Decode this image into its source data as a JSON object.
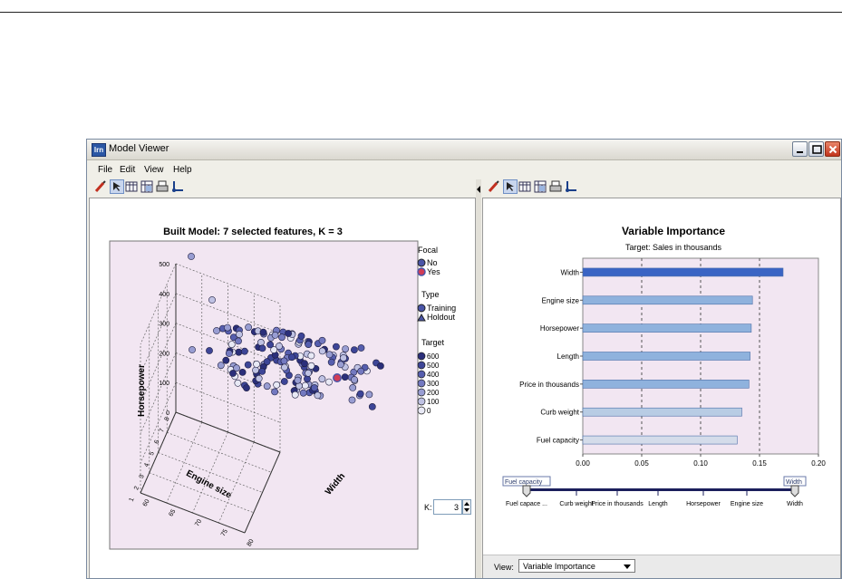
{
  "window": {
    "title": "Model Viewer",
    "app_icon_label": "lrn"
  },
  "menu": [
    "File",
    "Edit",
    "View",
    "Help"
  ],
  "left_chart": {
    "title": "Built Model: 7 selected features, K = 3",
    "axes": {
      "y_label": "Horsepower",
      "x_label": "Engine size",
      "z_label": "Width",
      "y_ticks": [
        "500",
        "400",
        "300",
        "200",
        "100",
        "0"
      ],
      "x_ticks": [
        "8",
        "7",
        "6",
        "5",
        "4",
        "3",
        "2",
        "1"
      ],
      "z_ticks": [
        "80",
        "75",
        "70",
        "65",
        "60"
      ]
    },
    "legend": {
      "focal_title": "Focal",
      "focal_items": [
        "No",
        "Yes"
      ],
      "type_title": "Type",
      "type_items": [
        "Training",
        "Holdout"
      ],
      "target_title": "Target",
      "target_items": [
        "600",
        "500",
        "400",
        "300",
        "200",
        "100",
        "0"
      ]
    },
    "k_label": "K:",
    "k_value": "3"
  },
  "chart_data": {
    "type": "bar",
    "title": "Variable Importance",
    "subtitle": "Target: Sales in thousands",
    "categories": [
      "Width",
      "Engine size",
      "Horsepower",
      "Length",
      "Price in thousands",
      "Curb weight",
      "Fuel capacity"
    ],
    "values": [
      0.17,
      0.144,
      0.143,
      0.142,
      0.141,
      0.135,
      0.131
    ],
    "xlim": [
      0,
      0.2
    ],
    "x_ticks": [
      "0.00",
      "0.05",
      "0.10",
      "0.15",
      "0.20"
    ],
    "grid": "vertical dashed",
    "colors": [
      "#3a64c4",
      "#8fb2dd",
      "#8fb2dd",
      "#8fb2dd",
      "#8fb2dd",
      "#b8cce4",
      "#d4dcea"
    ]
  },
  "slider": {
    "left_handle": "Fuel capacity",
    "right_handle": "Width",
    "labels": [
      "Fuel capace ...",
      "Curb weight",
      "Price in thousands",
      "Length",
      "Horsepower",
      "Engine size",
      "Width"
    ]
  },
  "footer": {
    "view_label": "View:",
    "view_value": "Variable Importance"
  },
  "colors": {
    "plot_bg": "#f2e6f2",
    "point": "#4a55a8",
    "focal_yes": "#d13c56"
  }
}
